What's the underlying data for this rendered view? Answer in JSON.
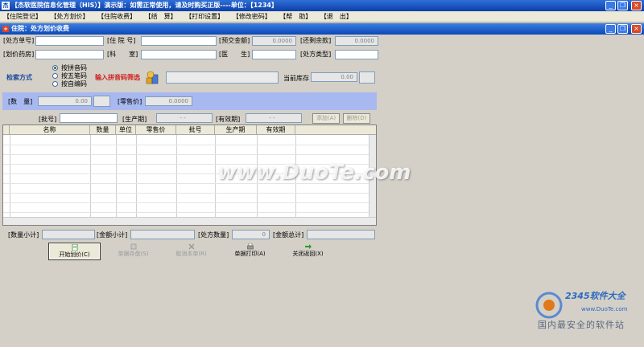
{
  "window": {
    "title": "【杰软医院信息化管理（HIS）】演示版：如需正常使用，请及时购买正版----单位：【1234】",
    "controls": [
      "_",
      "❐",
      "×"
    ]
  },
  "menu": [
    "【住院登记】",
    "【处方划价】",
    "【住院收费】",
    "【结　算】",
    "【打印设置】",
    "【修改密码】",
    "【帮　助】",
    "【退　出】"
  ],
  "subwindow": {
    "title": "住院：处方划价收费",
    "controls": [
      "_",
      "❐",
      "×"
    ]
  },
  "form": {
    "row1": {
      "rx_no_label": "[处方单号]",
      "inpatient_no_label": "[住 院 号]",
      "prepay_label": "[预交金额]",
      "prepay_value": "0.0000",
      "balance_label": "[还剩余款]",
      "balance_value": "0.0000"
    },
    "row2": {
      "pharmacy_label": "[划价药房]",
      "dept_label": "[科　　室]",
      "doctor_label": "[医　　生]",
      "rx_type_label": "[处方类型]"
    }
  },
  "search": {
    "label": "检索方式",
    "options": [
      "按拼音码",
      "按五笔码",
      "按自编码"
    ],
    "selected": 0,
    "input_label": "输入拼音码筛选",
    "stock_label": "当前库存",
    "stock_value": "0.00"
  },
  "qty": {
    "qty_label": "[数　量]",
    "qty_value": "0.00",
    "price_label": "[零售价]",
    "price_value": "0.0000"
  },
  "batch": {
    "batch_label": "[批号]",
    "mfg_label": "[生产期]",
    "mfg_value": "-  -",
    "exp_label": "[有效期]",
    "exp_value": "-  -",
    "add_btn": "添加(A)",
    "del_btn": "删除(D)"
  },
  "grid": {
    "columns": [
      "名称",
      "数量",
      "单位",
      "零售价",
      "批号",
      "生产期",
      "有效期"
    ]
  },
  "summary": {
    "qty_sub": "[数量小计]",
    "amt_sub": "[金额小计]",
    "rx_count": "[处方数量]",
    "rx_count_value": "0",
    "amt_total": "[金额总计]"
  },
  "actions": [
    {
      "label": "开始划价(C)",
      "state": "enabled"
    },
    {
      "label": "单据存盘(S)",
      "state": "disabled"
    },
    {
      "label": "取消本单(R)",
      "state": "disabled"
    },
    {
      "label": "单据打印(A)",
      "state": "enabled"
    },
    {
      "label": "关闭返回(X)",
      "state": "enabled"
    }
  ],
  "watermarks": {
    "duote": "www.DuoTe.com",
    "brand_2345": "2345软件大全",
    "brand_url": "www.DuoTe.com",
    "slogan": "国内最安全的软件站"
  }
}
